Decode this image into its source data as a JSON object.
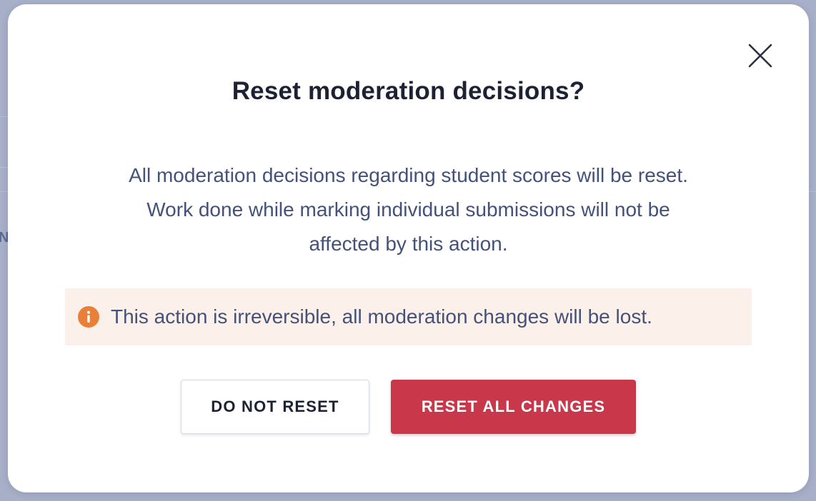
{
  "dialog": {
    "title": "Reset moderation decisions?",
    "description_lines": [
      "All moderation decisions regarding student scores will be reset.",
      "Work done while marking individual submissions will not be",
      "affected by this action."
    ],
    "warning": {
      "icon": "info-icon",
      "text": "This action is irreversible, all moderation changes will be lost."
    },
    "buttons": {
      "cancel_label": "DO NOT RESET",
      "confirm_label": "RESET ALL CHANGES"
    },
    "close_icon": "close-icon"
  },
  "backdrop": {
    "left_glyph": "N"
  },
  "colors": {
    "overlay": "#a7b0c8",
    "title": "#1c2133",
    "body_text": "#44527a",
    "warning_bg": "#fcf0ea",
    "warning_icon": "#e8803a",
    "danger": "#c9374a"
  }
}
